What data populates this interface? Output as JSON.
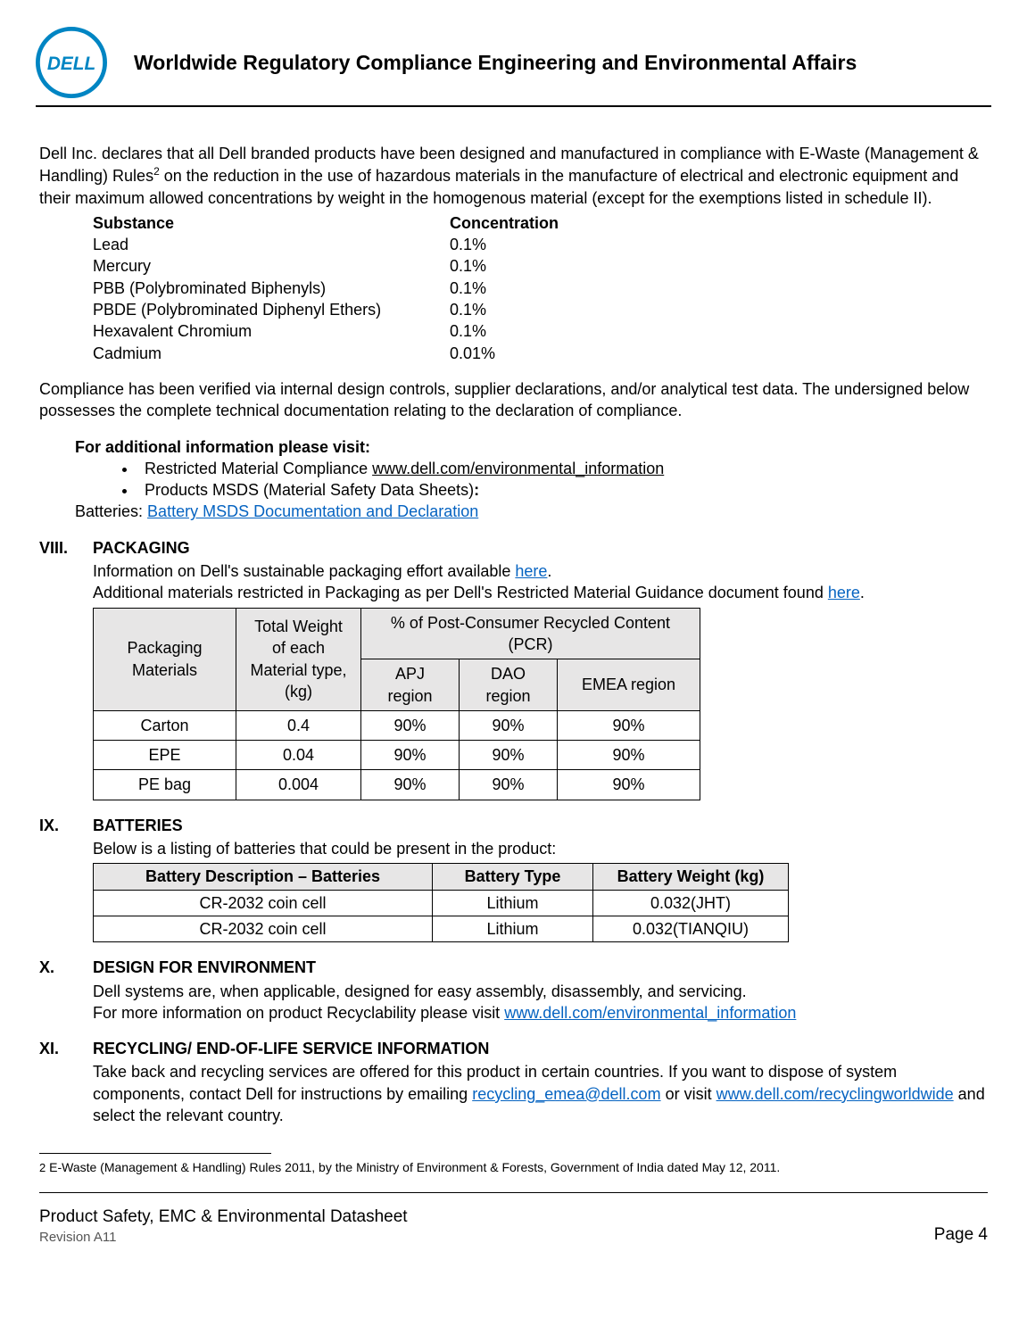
{
  "header": {
    "title": "Worldwide Regulatory Compliance Engineering and Environmental Affairs"
  },
  "intro": {
    "text_a": "Dell Inc. declares that all Dell branded products have been designed and manufactured in compliance with  E-Waste (Management & Handling) Rules",
    "sup": "2",
    "text_b": "  on the reduction in the use of hazardous materials in the manufacture of electrical and electronic equipment and their  maximum allowed concentrations by weight  in the homogenous material (except for the exemptions listed in schedule II)."
  },
  "substances": {
    "headers": {
      "substance": "Substance",
      "concentration": "Concentration"
    },
    "rows": [
      {
        "substance": "Lead",
        "concentration": "0.1%"
      },
      {
        "substance": "Mercury",
        "concentration": "0.1%"
      },
      {
        "substance": "PBB (Polybrominated Biphenyls)",
        "concentration": "0.1%"
      },
      {
        "substance": "PBDE (Polybrominated Diphenyl Ethers)",
        "concentration": "0.1%"
      },
      {
        "substance": "Hexavalent Chromium",
        "concentration": "0.1%"
      },
      {
        "substance": "Cadmium",
        "concentration": "0.01%"
      }
    ]
  },
  "compliance_text": "Compliance has been verified via internal design controls, supplier declarations, and/or analytical test data. The undersigned below possesses the complete technical documentation relating to the declaration of compliance.",
  "additional": {
    "title": "For additional information please visit:",
    "bullet1_text": "Restricted Material Compliance ",
    "bullet1_link": "www.dell.com/environmental_information",
    "bullet2_text": "Products MSDS (Material Safety Data Sheets)",
    "bullet2_colon": ":",
    "batteries_label": "Batteries: ",
    "batteries_link": "Battery MSDS Documentation and Declaration"
  },
  "sections": {
    "viii": {
      "num": "VIII.",
      "title": "PACKAGING",
      "line1_a": "Information on Dell's sustainable packaging effort available ",
      "line1_link": "here",
      "line1_b": ".",
      "line2_a": "Additional materials restricted in Packaging as per Dell's Restricted Material Guidance document found ",
      "line2_link": "here",
      "line2_b": "."
    },
    "ix": {
      "num": "IX.",
      "title": "BATTERIES",
      "intro": "Below is a listing of batteries that could be present in the product:"
    },
    "x": {
      "num": "X.",
      "title": "DESIGN FOR ENVIRONMENT",
      "line1": "Dell systems are, when applicable, designed for easy assembly, disassembly, and servicing.",
      "line2_a": "For more information on product Recyclability please visit ",
      "line2_link": "www.dell.com/environmental_information"
    },
    "xi": {
      "num": "XI.",
      "title": "RECYCLING/ END-OF-LIFE SERVICE INFORMATION",
      "text_a": "Take back and recycling services are offered for this product in certain countries. If you want to dispose of system components, contact Dell for instructions by emailing ",
      "link1": "recycling_emea@dell.com",
      "text_b": " or visit ",
      "link2": "www.dell.com/recyclingworldwide",
      "text_c": " and select the relevant country."
    }
  },
  "packaging_table": {
    "h_materials": "Packaging Materials",
    "h_weight": "Total Weight of each Material type, (kg)",
    "h_pcr": "% of Post-Consumer Recycled Content (PCR)",
    "h_apj": "APJ region",
    "h_dao": "DAO region",
    "h_emea": "EMEA region",
    "rows": [
      {
        "material": "Carton",
        "weight": "0.4",
        "apj": "90%",
        "dao": "90%",
        "emea": "90%"
      },
      {
        "material": "EPE",
        "weight": "0.04",
        "apj": "90%",
        "dao": "90%",
        "emea": "90%"
      },
      {
        "material": "PE bag",
        "weight": "0.004",
        "apj": "90%",
        "dao": "90%",
        "emea": "90%"
      }
    ]
  },
  "batteries_table": {
    "h_desc": "Battery Description – Batteries",
    "h_type": "Battery Type",
    "h_weight": "Battery Weight (kg)",
    "rows": [
      {
        "desc": "CR-2032 coin cell",
        "type": "Lithium",
        "weight": "0.032(JHT)"
      },
      {
        "desc": "CR-2032 coin cell",
        "type": "Lithium",
        "weight": "0.032(TIANQIU)"
      }
    ]
  },
  "footnote": {
    "num": "2",
    "text": " E-Waste (Management & Handling) Rules 2011, by the Ministry of Environment & Forests, Government of India dated May 12, 2011."
  },
  "footer": {
    "doc_title": "Product Safety, EMC & Environmental Datasheet",
    "revision": "Revision A11",
    "page": "Page 4"
  }
}
